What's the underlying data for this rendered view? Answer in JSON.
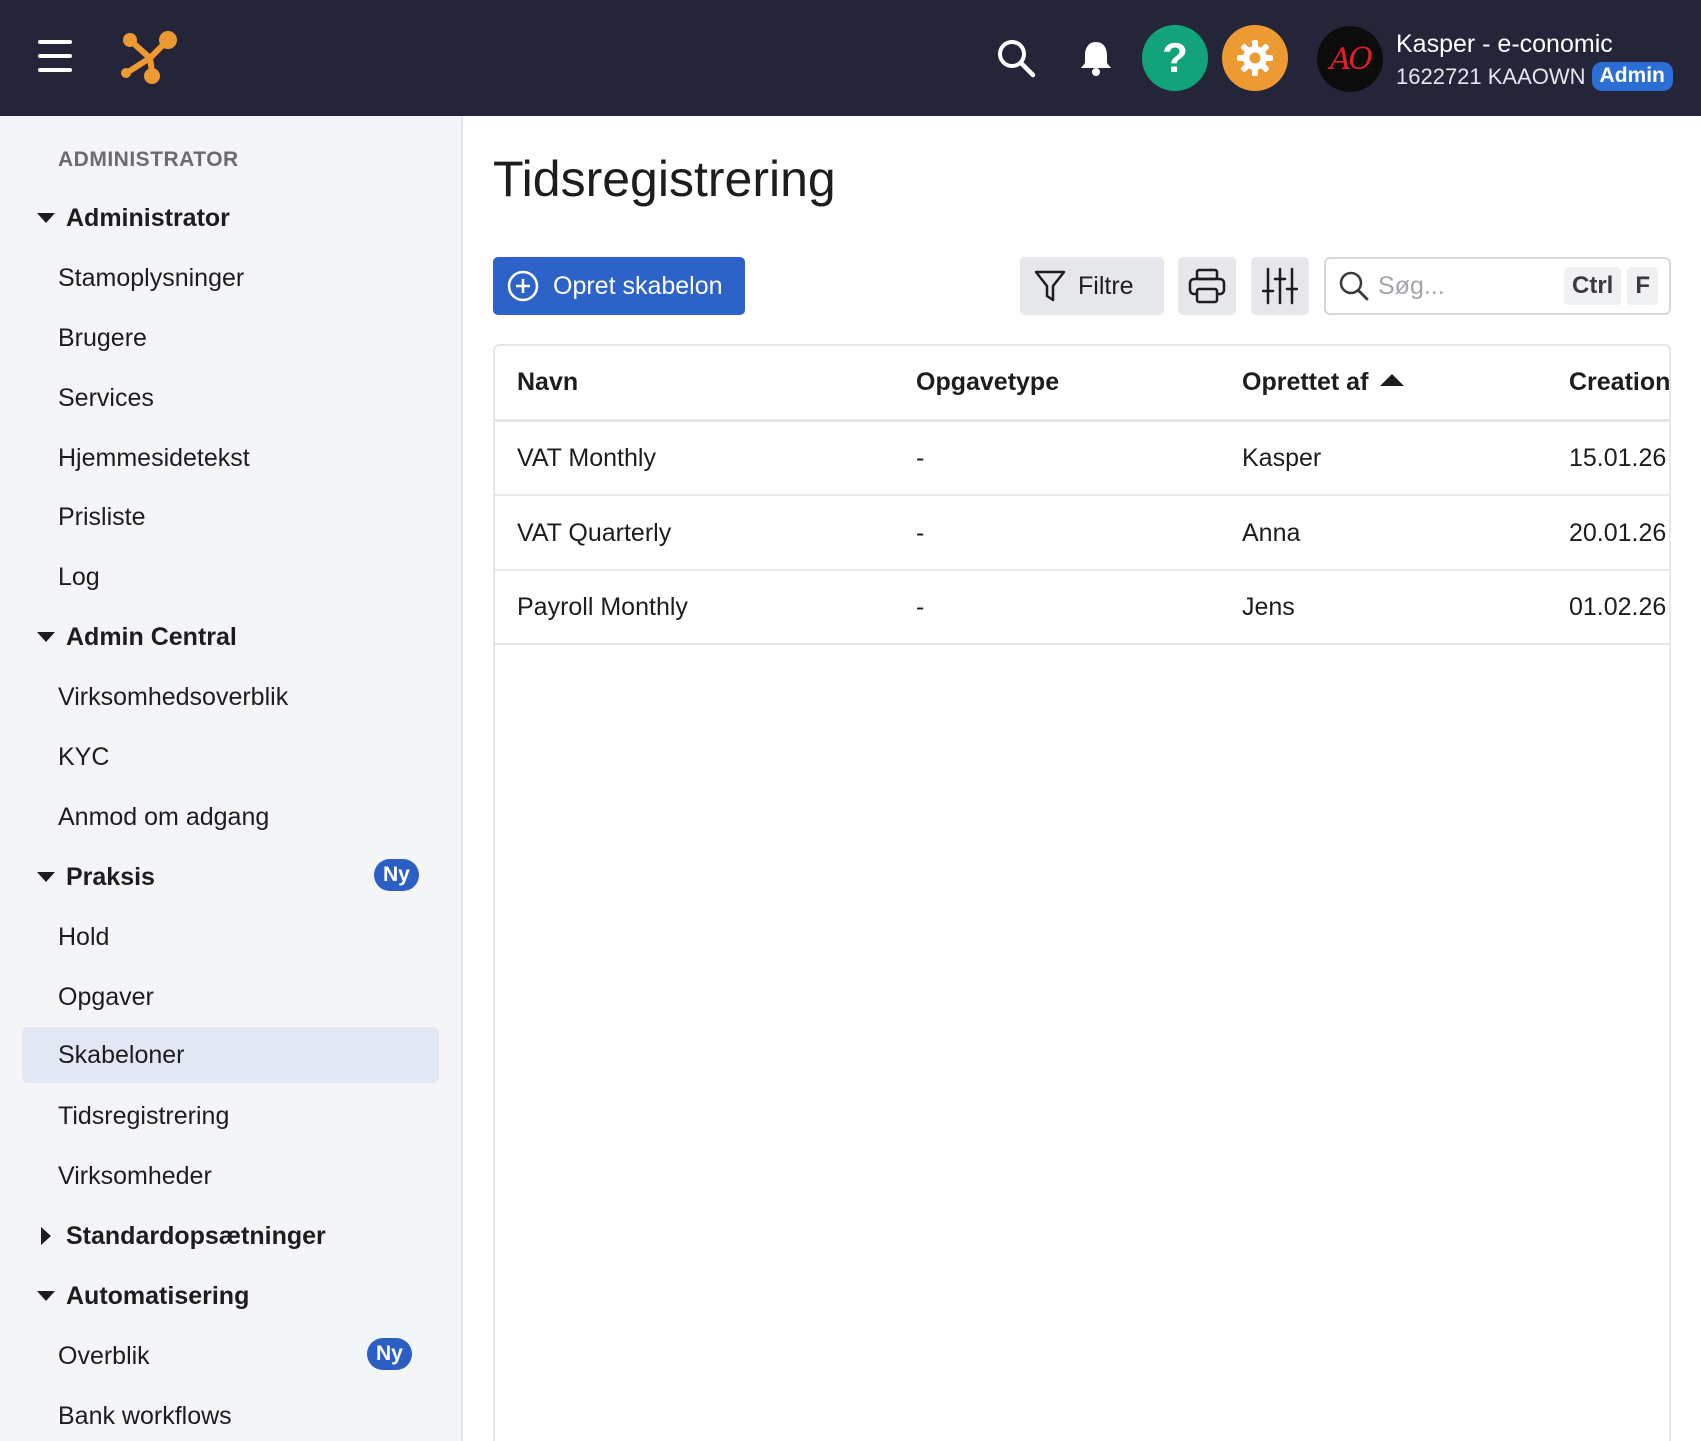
{
  "topbar": {
    "user_name": "Kasper - e-conomic",
    "user_account": "1622721 KAAOWN",
    "role_badge": "Admin",
    "avatar_text": "AO",
    "help_glyph": "?",
    "accent_colors": {
      "bar": "#25253a",
      "help": "#12a37b",
      "settings": "#ee9a33",
      "logo": "#ee9a33"
    },
    "icons": [
      "hamburger-icon",
      "logo",
      "search-icon",
      "bell-icon",
      "help-icon",
      "gear-icon"
    ]
  },
  "sidebar": {
    "section_label": "ADMINISTRATOR",
    "groups": [
      {
        "label": "Administrator",
        "expanded": true,
        "items": [
          "Stamoplysninger",
          "Brugere",
          "Services",
          "Hjemmesidetekst",
          "Prisliste",
          "Log"
        ]
      },
      {
        "label": "Admin Central",
        "expanded": true,
        "items": [
          "Virksomhedsoverblik",
          "KYC",
          "Anmod om adgang"
        ]
      },
      {
        "label": "Praksis",
        "expanded": true,
        "badge": "Ny",
        "items": [
          "Hold",
          "Opgaver",
          "Skabeloner",
          "Tidsregistrering",
          "Virksomheder"
        ]
      },
      {
        "label": "Standardopsætninger",
        "expanded": false
      },
      {
        "label": "Automatisering",
        "expanded": true,
        "items": [
          "Overblik",
          "Bank workflows"
        ],
        "overblik_badge": "Ny"
      }
    ],
    "active_item": "Skabeloner"
  },
  "main": {
    "title": "Tidsregistrering",
    "create_button": "Opret skabelon",
    "filter_button": "Filtre",
    "search_placeholder": "Søg...",
    "shortcut_ctrl": "Ctrl",
    "shortcut_key": "F",
    "table": {
      "columns": [
        "Navn",
        "Opgavetype",
        "Oprettet af",
        "Creation"
      ],
      "sorted_column": "Oprettet af",
      "sort_direction": "ascending",
      "rows": [
        [
          "VAT Monthly",
          "-",
          "Kasper",
          "15.01.26"
        ],
        [
          "VAT Quarterly",
          "-",
          "Anna",
          "20.01.26"
        ],
        [
          "Payroll Monthly",
          "-",
          "Jens",
          "01.02.26"
        ]
      ]
    }
  }
}
